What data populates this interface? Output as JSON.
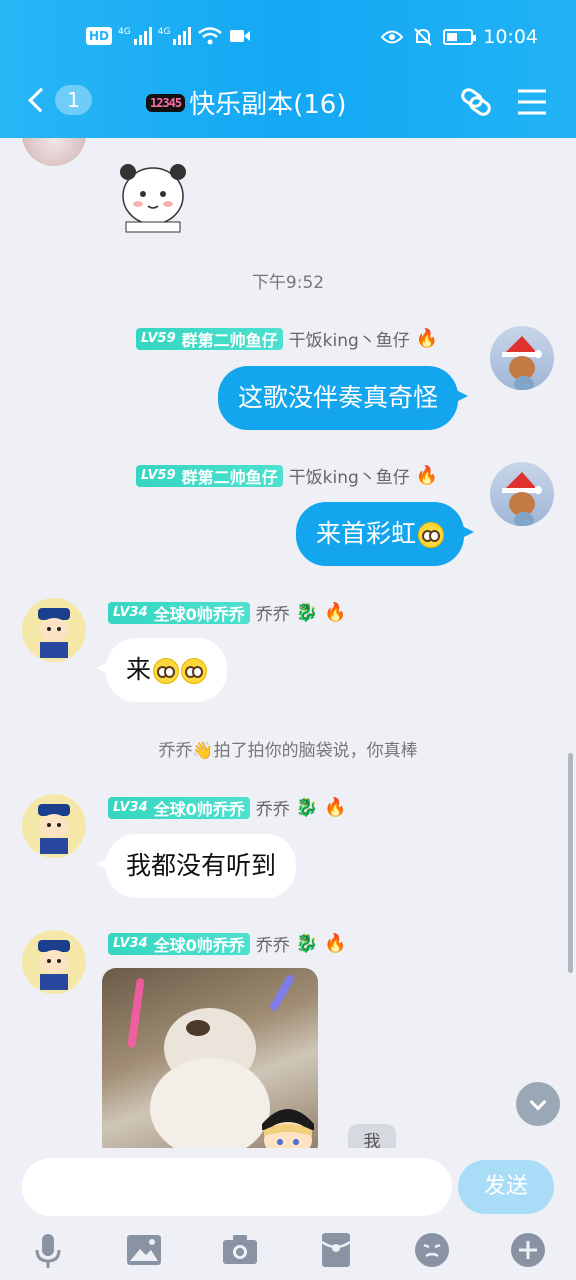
{
  "status_bar": {
    "left_badge": "HD",
    "network_1": "4G",
    "network_2": "4G",
    "time": "10:04"
  },
  "title_bar": {
    "unread_count": "1",
    "group_logo_text": "12345",
    "group_name": "快乐副本(16)"
  },
  "messages": {
    "time_separator": "下午9:52",
    "out_1": {
      "level": "LV59",
      "title": "群第二帅鱼仔",
      "nickname": "干饭king丶鱼仔",
      "text": "这歌没伴奏真奇怪"
    },
    "out_2": {
      "level": "LV59",
      "title": "群第二帅鱼仔",
      "nickname": "干饭king丶鱼仔",
      "text": "来首彩虹"
    },
    "in_1": {
      "level": "LV34",
      "title": "全球0帅乔乔",
      "nickname": "乔乔",
      "text": "来"
    },
    "system": {
      "actor": "乔乔",
      "action": "拍了拍你的脑袋说，你真棒"
    },
    "in_2": {
      "level": "LV34",
      "title": "全球0帅乔乔",
      "nickname": "乔乔",
      "text": "我都没有听到"
    },
    "in_3": {
      "level": "LV34",
      "title": "全球0帅乔乔",
      "nickname": "乔乔"
    },
    "me_badge": "我"
  },
  "input": {
    "value": "",
    "placeholder": "",
    "send_label": "发送"
  },
  "toolbar_icons": [
    "mic-icon",
    "image-icon",
    "camera-icon",
    "red-packet-icon",
    "emoji-icon",
    "plus-icon"
  ],
  "colors": {
    "header": "#14a8f4",
    "bubble_out": "#13a6ee",
    "bubble_in": "#ffffff",
    "level_tag": "#35d6c1",
    "send_disabled": "#a8dcf7"
  }
}
